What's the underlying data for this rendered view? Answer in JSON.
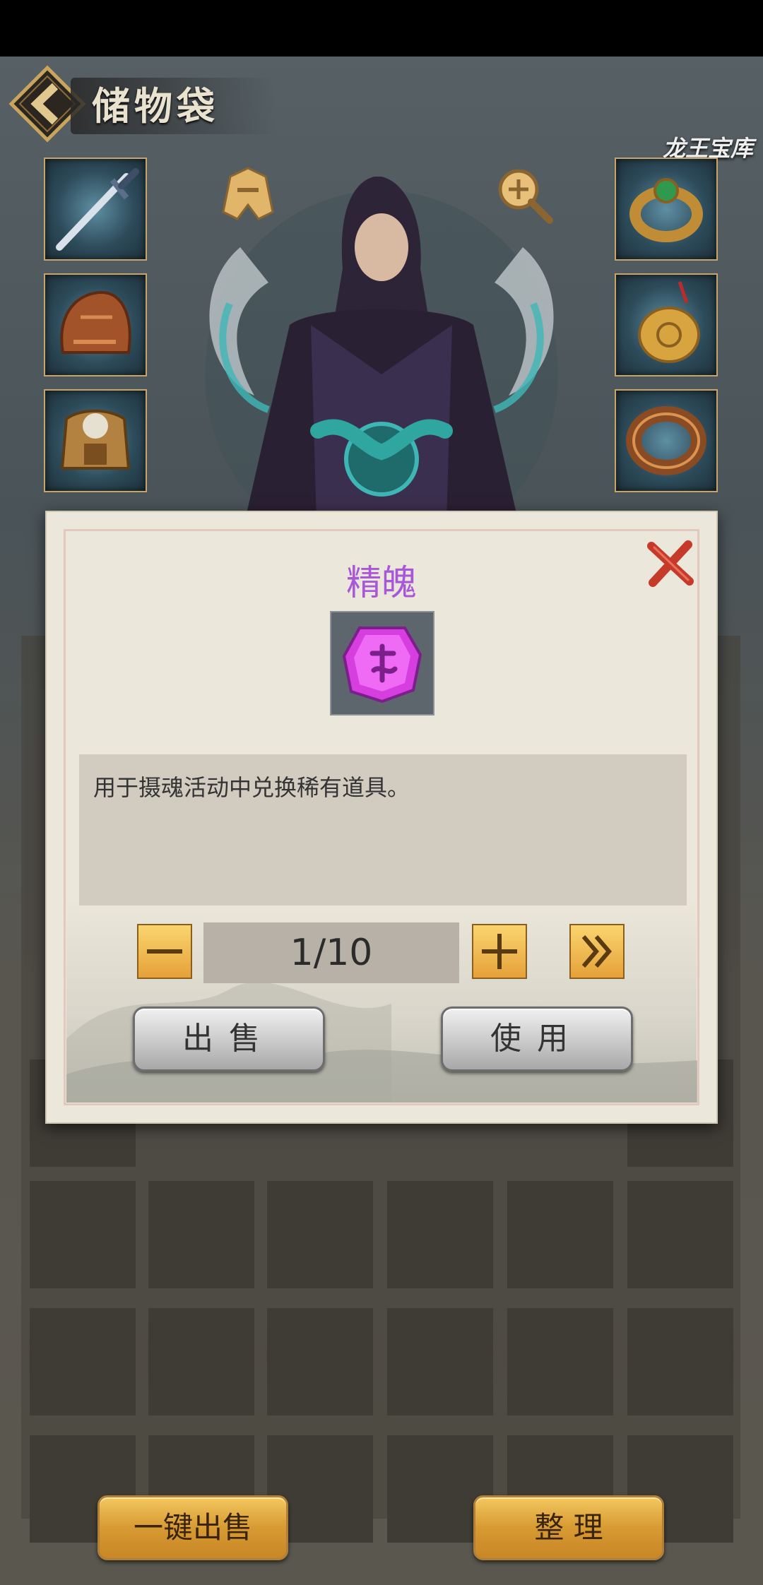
{
  "header": {
    "title": "储物袋",
    "vault_logo_text": "龙王宝库"
  },
  "equipment": {
    "left_slots": [
      "sword-icon",
      "helmet-icon",
      "armor-icon"
    ],
    "right_slots": [
      "ring-icon",
      "pendant-icon",
      "bracelet-icon"
    ]
  },
  "bottom_buttons": {
    "sell_all_label": "一键出售",
    "sort_label": "整 理"
  },
  "modal": {
    "item_name": "精魄",
    "item_icon": "purple-gem-icon",
    "description": "用于摄魂活动中兑换稀有道具。",
    "quantity_text": "1/10",
    "sell_label": "出售",
    "use_label": "使用"
  },
  "colors": {
    "title_purple": "#a857d8",
    "gold_button": "#e6a13a",
    "modal_bg": "#ebe7da"
  }
}
